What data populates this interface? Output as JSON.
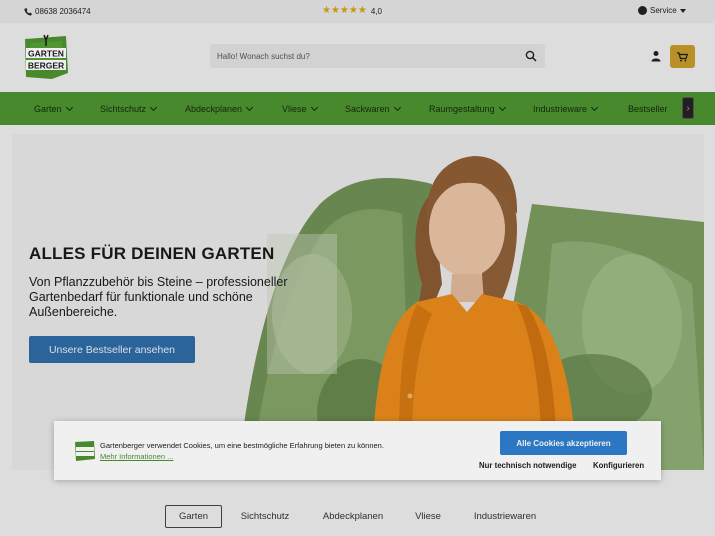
{
  "topbar": {
    "phone_icon": "phone-icon",
    "phone": "08638 2036474",
    "rating_stars": 5,
    "rating_value": "4,0",
    "service_label": "Service",
    "service_icon": "chat-icon"
  },
  "header": {
    "logo_line1": "GARTEN",
    "logo_line2": "BERGER",
    "search_placeholder": "Hallo! Wonach suchst du?",
    "search_icon": "search-icon",
    "account_icon": "user-icon",
    "cart_icon": "cart-icon"
  },
  "colors": {
    "nav_green": "#4e9230",
    "cta_blue": "#2e6aa5",
    "cookie_accept_blue": "#2f7fd1",
    "cart_gold": "#c59a2a",
    "star_gold": "#d4a017"
  },
  "nav": {
    "items": [
      {
        "label": "Garten"
      },
      {
        "label": "Sichtschutz"
      },
      {
        "label": "Abdeckplanen"
      },
      {
        "label": "Vliese"
      },
      {
        "label": "Sackwaren"
      },
      {
        "label": "Raumgestaltung"
      },
      {
        "label": "Industrieware"
      },
      {
        "label": "Bestseller"
      }
    ],
    "next_icon": "chevron-right-icon"
  },
  "hero": {
    "title": "ALLES FÜR DEINEN GARTEN",
    "subtitle": "Von Pflanzzubehör bis Steine – professioneller Gartenbedarf für funktionale und schöne Außenbereiche.",
    "cta": "Unsere Bestseller ansehen"
  },
  "cookie": {
    "text": "Gartenberger verwendet Cookies, um eine bestmögliche Erfahrung bieten zu können.",
    "more_link": "Mehr Informationen ...",
    "accept_all": "Alle Cookies akzeptieren",
    "technical_only": "Nur technisch notwendige",
    "configure": "Konfigurieren"
  },
  "category_tabs": [
    {
      "label": "Garten",
      "active": true
    },
    {
      "label": "Sichtschutz",
      "active": false
    },
    {
      "label": "Abdeckplanen",
      "active": false
    },
    {
      "label": "Vliese",
      "active": false
    },
    {
      "label": "Industriewaren",
      "active": false
    }
  ]
}
